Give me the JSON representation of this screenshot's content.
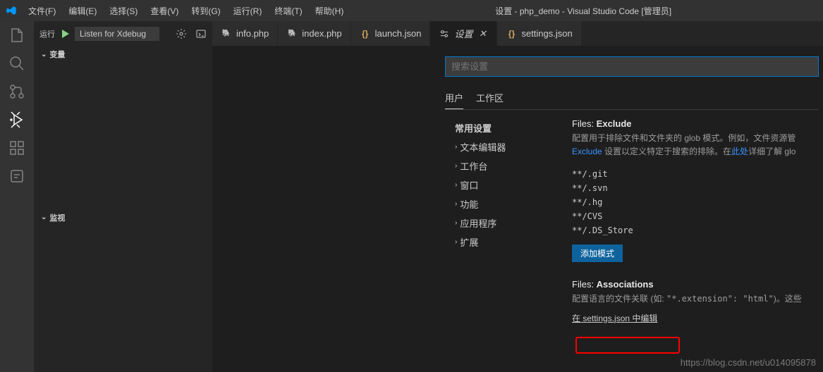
{
  "window": {
    "title": "设置 - php_demo - Visual Studio Code [管理员]"
  },
  "menu": {
    "file": "文件(F)",
    "edit": "编辑(E)",
    "select": "选择(S)",
    "view": "查看(V)",
    "goto": "转到(G)",
    "run": "运行(R)",
    "terminal": "终端(T)",
    "help": "帮助(H)"
  },
  "debug": {
    "run_label": "运行",
    "config": "Listen for Xdebug",
    "section_vars": "变量",
    "section_watch": "监视"
  },
  "tabs": {
    "info_php": "info.php",
    "index_php": "index.php",
    "launch_json": "launch.json",
    "settings_title": "设置",
    "settings_json": "settings.json"
  },
  "settings": {
    "search_placeholder": "搜索设置",
    "scope_user": "用户",
    "scope_workspace": "工作区",
    "toc": {
      "root": "常用设置",
      "text_editor": "文本编辑器",
      "workbench": "工作台",
      "window": "窗口",
      "features": "功能",
      "application": "应用程序",
      "extensions": "扩展"
    },
    "exclude": {
      "prefix": "Files: ",
      "name": "Exclude",
      "desc": "配置用于排除文件和文件夹的 glob 模式。例如，文件资源管",
      "link1": "Exclude",
      "desc2": " 设置以定义特定于搜索的排除。在",
      "link2": "此处",
      "desc3": "详细了解 glo",
      "patterns": [
        "**/.git",
        "**/.svn",
        "**/.hg",
        "**/CVS",
        "**/.DS_Store"
      ],
      "add_btn": "添加模式"
    },
    "associations": {
      "prefix": "Files: ",
      "name": "Associations",
      "desc_a": "配置语言的文件关联 (如: ",
      "desc_code": "\"*.extension\": \"html\"",
      "desc_b": ")。这些",
      "edit_link": "在 settings.json 中编辑"
    }
  },
  "watermark": "https://blog.csdn.net/u014095878"
}
